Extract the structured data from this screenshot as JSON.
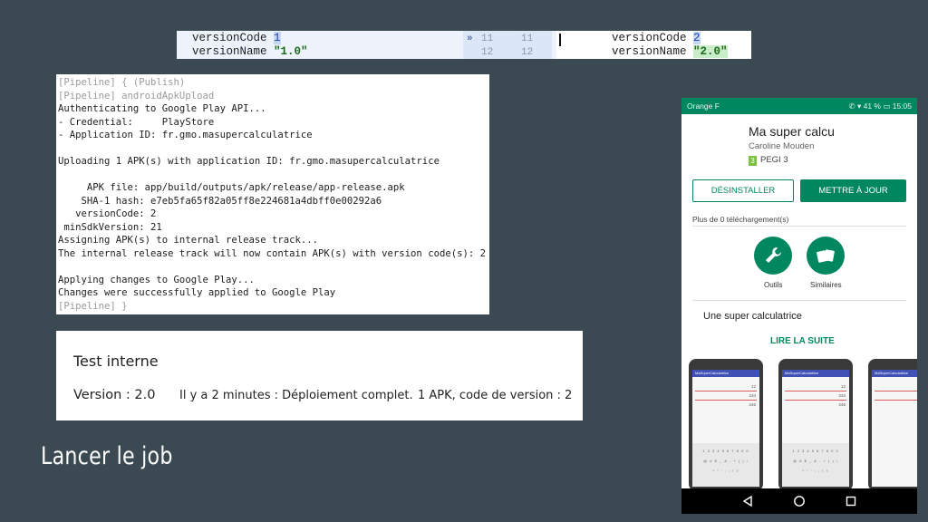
{
  "diff": {
    "left": {
      "line1_key": "versionCode ",
      "line1_val": "1",
      "line2_key": "versionName ",
      "line2_val": "\"1.0\""
    },
    "gutter": [
      {
        "marker": "»",
        "a": "11",
        "b": "11"
      },
      {
        "marker": "",
        "a": "12",
        "b": "12"
      }
    ],
    "right": {
      "line1_key": "versionCode ",
      "line1_val": "2",
      "line2_key": "versionName ",
      "line2_val": "\"2.0\""
    }
  },
  "console": {
    "lines": [
      "[Pipeline] { (Publish)",
      "[Pipeline] androidApkUpload",
      "Authenticating to Google Play API...",
      "- Credential:     PlayStore",
      "- Application ID: fr.gmo.masupercalculatrice",
      "",
      "Uploading 1 APK(s) with application ID: fr.gmo.masupercalculatrice",
      "",
      "     APK file: app/build/outputs/apk/release/app-release.apk",
      "    SHA-1 hash: e7eb5fa65f82a05ff8e224681a4dbff0e00292a6",
      "   versionCode: 2",
      " minSdkVersion: 21",
      "Assigning APK(s) to internal release track...",
      "The internal release track will now contain APK(s) with version code(s): 2",
      "",
      "Applying changes to Google Play...",
      "Changes were successfully applied to Google Play",
      "[Pipeline] }"
    ]
  },
  "track": {
    "title": "Test interne",
    "version": "Version : 2.0",
    "deploy": "Il y a 2 minutes : Déploiement complet.",
    "apk": "1 APK, code de version : 2"
  },
  "caption": "Lancer le job",
  "phone": {
    "status": {
      "carrier": "Orange F",
      "right": "✆ ▾ 41 % ▭ 15:05"
    },
    "app_title": "Ma super calcu",
    "developer": "Caroline Mouden",
    "pegi_badge": "3",
    "pegi": "PEGI 3",
    "uninstall": "DÉSINSTALLER",
    "update": "METTRE À JOUR",
    "downloads": "Plus de 0 téléchargement(s)",
    "categories": [
      {
        "label": "Outils"
      },
      {
        "label": "Similaires"
      }
    ],
    "description": "Une super calculatrice",
    "read_more": "LIRE LA SUITE",
    "screenshot": {
      "app_bar": "MaSuperCalculatrice",
      "values": [
        "12",
        "234",
        "246"
      ],
      "keyboard_rows": [
        "1 2 3 4 5 6 7 8 9 0",
        "@ # $ _ & - + ( ) /",
        "* \" ' : ; ! ?"
      ]
    }
  },
  "colors": {
    "background": "#3b4a52",
    "play_green": "#01875f"
  }
}
